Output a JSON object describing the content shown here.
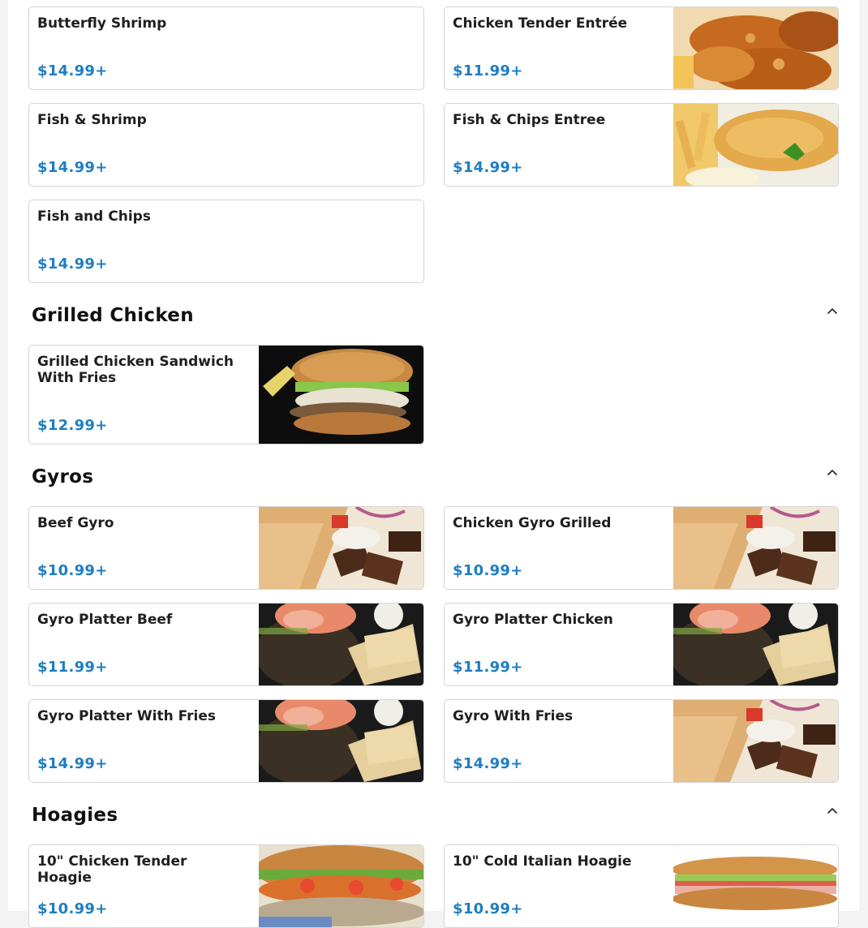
{
  "sections": [
    {
      "title": "",
      "icon": "",
      "items": [
        {
          "name": "Butterfly Shrimp",
          "price": "$14.99+"
        },
        {
          "name": "Chicken Tender Entrée",
          "price": "$11.99+",
          "image": "fried-chicken-tenders-photo"
        },
        {
          "name": "Fish & Shrimp",
          "price": "$14.99+"
        },
        {
          "name": "Fish & Chips Entree",
          "price": "$14.99+",
          "image": "fried-fish-fillet-photo"
        },
        {
          "name": "Fish and Chips",
          "price": "$14.99+"
        }
      ]
    },
    {
      "title": "Grilled Chicken",
      "icon": "chevron-up-icon",
      "items": [
        {
          "name": "Grilled Chicken Sandwich With Fries",
          "price": "$12.99+",
          "image": "chicken-sandwich-photo"
        }
      ]
    },
    {
      "title": "Gyros",
      "icon": "chevron-up-icon",
      "items": [
        {
          "name": "Beef Gyro",
          "price": "$10.99+",
          "image": "gyro-wrap-photo"
        },
        {
          "name": "Chicken Gyro Grilled",
          "price": "$10.99+",
          "image": "gyro-wrap-photo"
        },
        {
          "name": "Gyro Platter Beef",
          "price": "$11.99+",
          "image": "gyro-platter-photo"
        },
        {
          "name": "Gyro Platter Chicken",
          "price": "$11.99+",
          "image": "gyro-platter-photo"
        },
        {
          "name": "Gyro Platter With Fries",
          "price": "$14.99+",
          "image": "gyro-platter-photo"
        },
        {
          "name": "Gyro With Fries",
          "price": "$14.99+",
          "image": "gyro-wrap-photo"
        }
      ]
    },
    {
      "title": "Hoagies",
      "icon": "chevron-up-icon",
      "items": [
        {
          "name": "10\" Chicken Tender Hoagie",
          "price": "$10.99+",
          "image": "chicken-hoagie-photo"
        },
        {
          "name": "10\" Cold Italian Hoagie",
          "price": "$10.99+",
          "image": "italian-hoagie-photo"
        }
      ]
    }
  ],
  "colors": {
    "price": "#1f7ec2",
    "border": "#d5d5d5",
    "background": "#ffffff"
  }
}
